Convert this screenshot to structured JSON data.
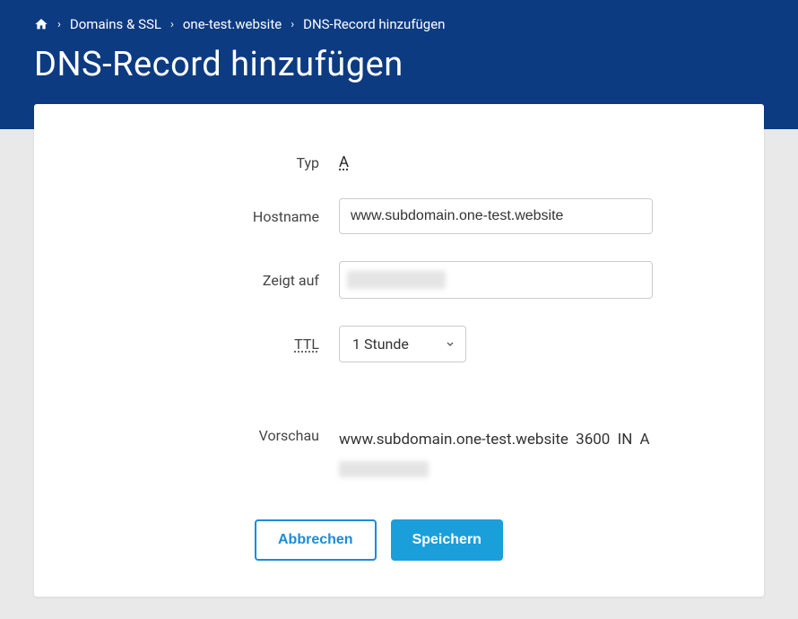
{
  "breadcrumb": {
    "items": [
      "Domains & SSL",
      "one-test.website",
      "DNS-Record hinzufügen"
    ]
  },
  "page_title": "DNS-Record hinzufügen",
  "form": {
    "type_label": "Typ",
    "type_value": "A",
    "hostname_label": "Hostname",
    "hostname_value": "www.subdomain.one-test.website",
    "pointsto_label": "Zeigt auf",
    "pointsto_value": "",
    "ttl_label": "TTL",
    "ttl_value": "1 Stunde"
  },
  "preview": {
    "label": "Vorschau",
    "line1": "www.subdomain.one-test.website  3600  IN  A"
  },
  "buttons": {
    "cancel": "Abbrechen",
    "save": "Speichern"
  }
}
